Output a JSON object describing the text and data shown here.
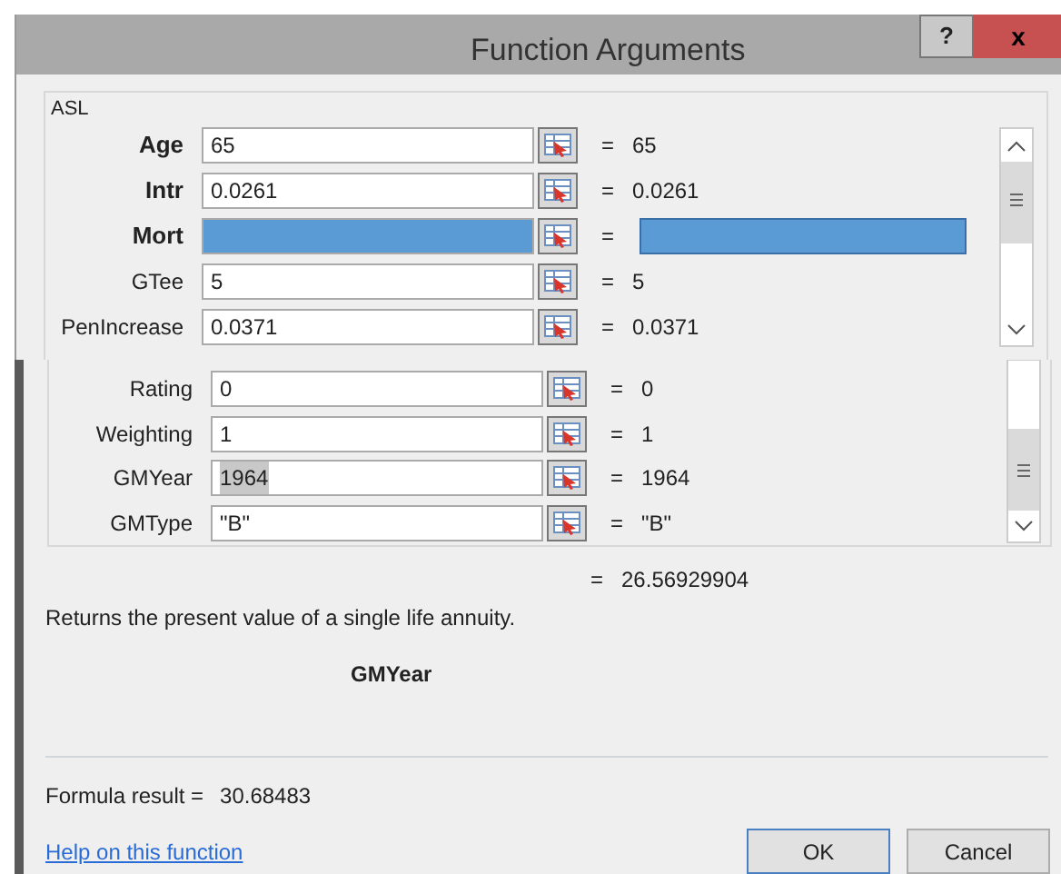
{
  "window": {
    "title": "Function Arguments",
    "help_button": "?",
    "close_button": "x"
  },
  "group_label": "ASL",
  "arguments_top": [
    {
      "name": "Age",
      "value": "65",
      "result": "= 65",
      "required": true,
      "highlighted": false,
      "text_selected": false
    },
    {
      "name": "Intr",
      "value": "0.0261",
      "result": "= 0.0261",
      "required": true,
      "highlighted": false,
      "text_selected": false
    },
    {
      "name": "Mort",
      "result": "=",
      "required": true,
      "highlighted": true
    },
    {
      "name": "GTee",
      "value": "5",
      "result": "= 5",
      "required": false,
      "highlighted": false,
      "text_selected": false
    },
    {
      "name": "PenIncrease",
      "value": "0.0371",
      "result": "= 0.0371",
      "required": false,
      "highlighted": false,
      "text_selected": false
    }
  ],
  "arguments_bottom": [
    {
      "name": "Rating",
      "value": "0",
      "result": "= 0",
      "required": false,
      "highlighted": false,
      "text_selected": false
    },
    {
      "name": "Weighting",
      "value": "1",
      "result": "= 1",
      "required": false,
      "highlighted": false,
      "text_selected": false
    },
    {
      "name": "GMYear",
      "value": "1964",
      "result": "= 1964",
      "required": false,
      "highlighted": false,
      "text_selected": true
    },
    {
      "name": "GMType",
      "value": "\"B\"",
      "result": "= \"B\"",
      "required": false,
      "highlighted": false,
      "text_selected": false
    }
  ],
  "function_result": "= 26.56929904",
  "description": "Returns the present value of a single life annuity.",
  "argument_help": "GMYear",
  "formula_result": {
    "label": "Formula result =",
    "value": "30.68483"
  },
  "help_link": "Help on this function",
  "buttons": [
    "OK",
    "Cancel"
  ]
}
